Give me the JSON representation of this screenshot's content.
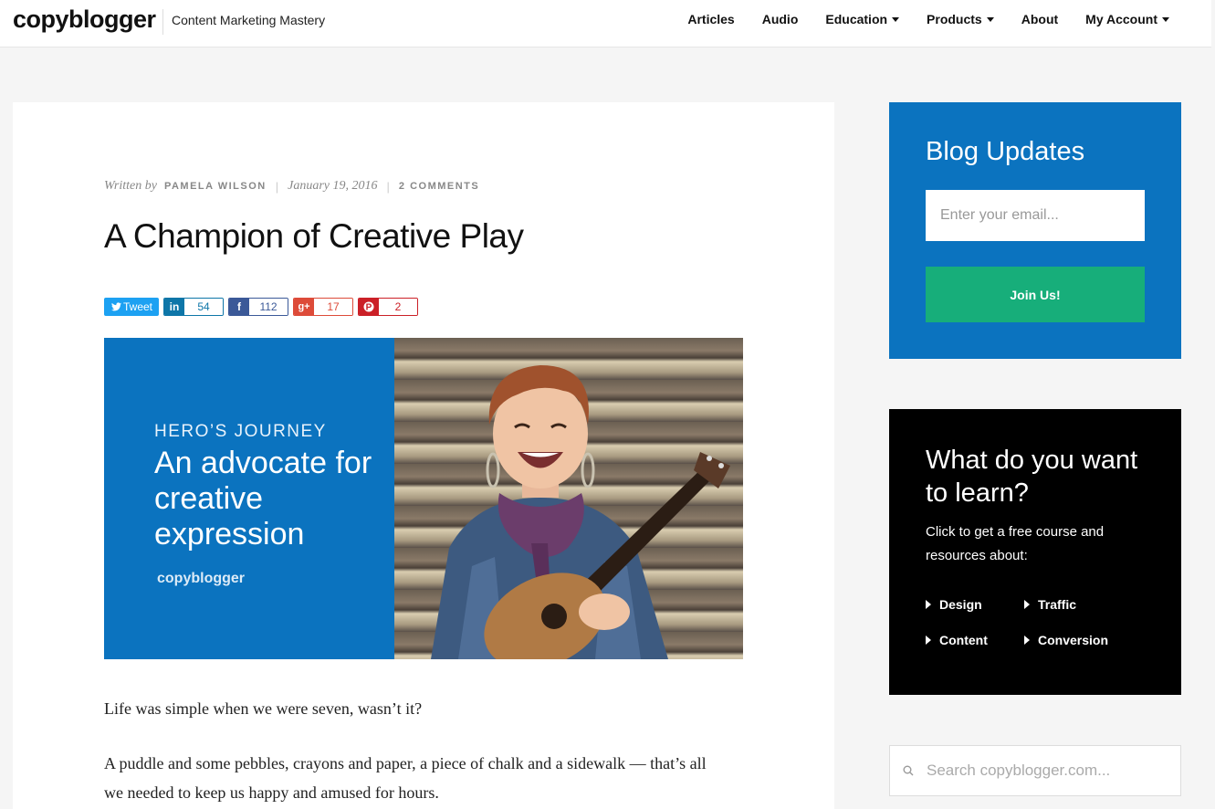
{
  "header": {
    "logo": "copyblogger",
    "tagline": "Content Marketing Mastery",
    "nav": [
      {
        "label": "Articles",
        "dropdown": false
      },
      {
        "label": "Audio",
        "dropdown": false
      },
      {
        "label": "Education",
        "dropdown": true
      },
      {
        "label": "Products",
        "dropdown": true
      },
      {
        "label": "About",
        "dropdown": false
      },
      {
        "label": "My Account",
        "dropdown": true
      }
    ]
  },
  "article": {
    "written_by": "Written by",
    "author": "PAMELA WILSON",
    "date": "January 19, 2016",
    "comments": "2 COMMENTS",
    "title": "A Champion of Creative Play",
    "shares": {
      "tweet": "Tweet",
      "linkedin": "54",
      "facebook": "112",
      "googleplus": "17",
      "pinterest": "2"
    },
    "hero": {
      "kicker": "HERO’S JOURNEY",
      "headline": "An advocate for creative expression",
      "brand": "copyblogger"
    },
    "paragraphs": [
      "Life was simple when we were seven, wasn’t it?",
      "A puddle and some pebbles, crayons and paper, a piece of chalk and a sidewalk — that’s all we needed to keep us happy and amused for hours."
    ]
  },
  "sidebar": {
    "updates": {
      "title": "Blog Updates",
      "email_placeholder": "Enter your email...",
      "button": "Join Us!"
    },
    "learn": {
      "title": "What do you want to learn?",
      "desc": "Click to get a free course and resources about:",
      "topics": [
        "Design",
        "Traffic",
        "Content",
        "Conversion"
      ]
    },
    "search_placeholder": "Search copyblogger.com..."
  },
  "colors": {
    "brand_blue": "#0b73bf",
    "join_green": "#17ae7a",
    "twitter": "#1da1f2",
    "linkedin": "#0e76a8",
    "facebook": "#3b5998",
    "googleplus": "#dd4b39",
    "pinterest": "#cb2027"
  }
}
